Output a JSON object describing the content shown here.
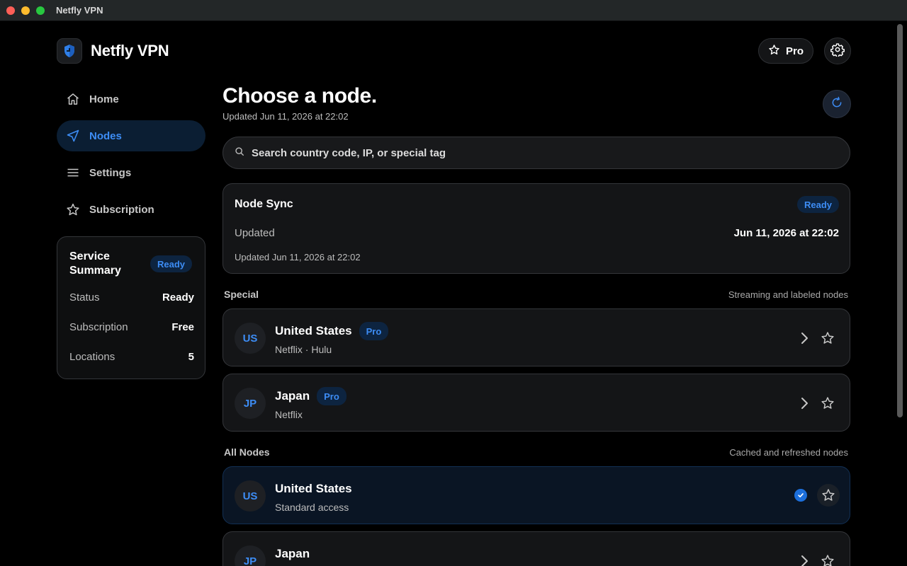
{
  "window": {
    "title": "Netfly VPN"
  },
  "brand": {
    "name": "Netfly VPN",
    "logo_icon": "shield-icon"
  },
  "header": {
    "pro_label": "Pro"
  },
  "nav": {
    "items": [
      {
        "label": "Home",
        "icon": "home-icon",
        "active": false
      },
      {
        "label": "Nodes",
        "icon": "navigation-arrow-icon",
        "active": true
      },
      {
        "label": "Settings",
        "icon": "menu-lines-icon",
        "active": false
      },
      {
        "label": "Subscription",
        "icon": "star-icon",
        "active": false
      }
    ]
  },
  "summary": {
    "title": "Service Summary",
    "badge": "Ready",
    "rows": [
      {
        "key": "Status",
        "value": "Ready"
      },
      {
        "key": "Subscription",
        "value": "Free"
      },
      {
        "key": "Locations",
        "value": "5"
      }
    ]
  },
  "main": {
    "title": "Choose a node.",
    "subtitle": "Updated Jun 11, 2026 at 22:02",
    "search_placeholder": "Search country code, IP, or special tag"
  },
  "sync": {
    "title": "Node Sync",
    "badge": "Ready",
    "label": "Updated",
    "value": "Jun 11, 2026 at 22:02",
    "footer": "Updated Jun 11, 2026 at 22:02"
  },
  "sections": {
    "special": {
      "title": "Special",
      "note": "Streaming and labeled nodes"
    },
    "all": {
      "title": "All Nodes",
      "note": "Cached and refreshed nodes"
    }
  },
  "special_nodes": [
    {
      "code": "US",
      "name": "United States",
      "badge": "Pro",
      "tags": "Netflix · Hulu"
    },
    {
      "code": "JP",
      "name": "Japan",
      "badge": "Pro",
      "tags": "Netflix"
    }
  ],
  "all_nodes": [
    {
      "code": "US",
      "name": "United States",
      "tags": "Standard access",
      "selected": true
    },
    {
      "code": "JP",
      "name": "Japan",
      "tags": "",
      "selected": false
    }
  ],
  "colors": {
    "accent": "#3d8df5",
    "background": "#000000",
    "card": "#141517",
    "selected_card": "#0a1524"
  }
}
